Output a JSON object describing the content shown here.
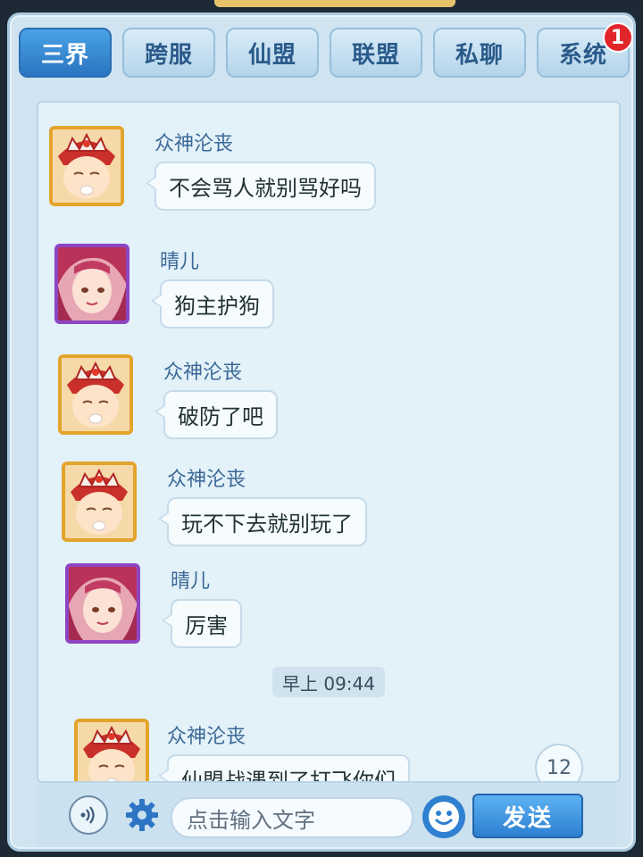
{
  "tabs": [
    {
      "label": "三界",
      "active": true
    },
    {
      "label": "跨服",
      "active": false
    },
    {
      "label": "仙盟",
      "active": false
    },
    {
      "label": "联盟",
      "active": false
    },
    {
      "label": "私聊",
      "active": false
    },
    {
      "label": "系统",
      "active": false,
      "badge": "1"
    }
  ],
  "messages": [
    {
      "sender": "众神沦丧",
      "text": "不会骂人就别骂好吗",
      "avatar": "deity-avatar-gold"
    },
    {
      "sender": "晴儿",
      "text": "狗主护狗",
      "avatar": "girl-avatar-purple"
    },
    {
      "sender": "众神沦丧",
      "text": "破防了吧",
      "avatar": "deity-avatar-gold"
    },
    {
      "sender": "众神沦丧",
      "text": "玩不下去就别玩了",
      "avatar": "deity-avatar-gold"
    },
    {
      "sender": "晴儿",
      "text": "厉害",
      "avatar": "girl-avatar-purple"
    },
    {
      "sender": "众神沦丧",
      "text": "仙盟战遇到了打飞你们",
      "avatar": "deity-avatar-gold"
    }
  ],
  "timestamp": "早上  09:44",
  "unread_count": "12",
  "input": {
    "placeholder": "点击输入文字"
  },
  "send_label": "发送",
  "icons": {
    "voice": "voice-icon",
    "settings": "gear-icon",
    "emoji": "emoji-icon"
  },
  "colors": {
    "accent": "#2a74c0",
    "badge": "#e0262b",
    "panel_bg": "#e3f1f8",
    "sender_name": "#3a6897"
  }
}
